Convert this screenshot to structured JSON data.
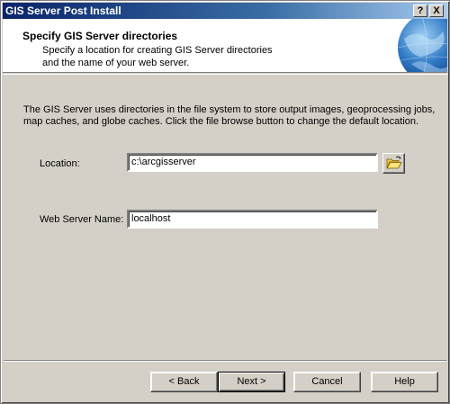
{
  "window": {
    "title": "GIS Server Post Install",
    "help_label": "?",
    "close_label": "X"
  },
  "header": {
    "title": "Specify GIS Server directories",
    "subtitle_line1": "Specify a location for creating GIS Server directories",
    "subtitle_line2": "and the name of your web server."
  },
  "description": {
    "line1": "The GIS Server uses directories in the file system to store output images, geoprocessing jobs,",
    "line2": "map caches, and globe caches.  Click the file browse button to change the default location."
  },
  "form": {
    "location_label": "Location:",
    "location_value": "c:\\arcgisserver",
    "webserver_label": "Web Server Name:",
    "webserver_value": "localhost"
  },
  "buttons": {
    "back": "< Back",
    "next": "Next >",
    "cancel": "Cancel",
    "help": "Help"
  },
  "icons": {
    "browse": "folder-open-icon",
    "header_graphic": "globe-icon"
  },
  "colors": {
    "titlebar_start": "#0a246a",
    "titlebar_end": "#a6caf0",
    "dialog_bg": "#d4d0c8",
    "folder": "#f2c84b"
  }
}
